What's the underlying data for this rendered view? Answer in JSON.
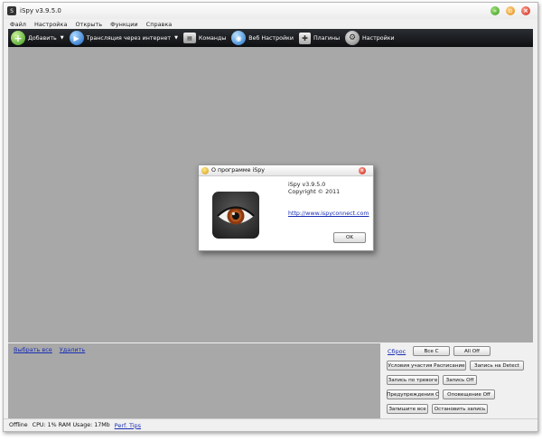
{
  "window": {
    "title": "iSpy v3.9.5.0",
    "app_icon": "S",
    "controls": [
      "minimize-icon",
      "maximize-icon",
      "close-icon"
    ]
  },
  "menu": {
    "items": [
      "Файл",
      "Настройка",
      "Открыть",
      "Функции",
      "Справка"
    ]
  },
  "toolbar": {
    "items": [
      {
        "label": "Добавить",
        "icon": "add-icon",
        "dropdown": true
      },
      {
        "label": "Трансляция через интернет",
        "icon": "broadcast-icon",
        "dropdown": true
      },
      {
        "label": "Команды",
        "icon": "commands-icon",
        "dropdown": false
      },
      {
        "label": "Веб Настройки",
        "icon": "globe-icon",
        "dropdown": false
      },
      {
        "label": "Плагины",
        "icon": "puzzle-icon",
        "dropdown": false
      },
      {
        "label": "Настройки",
        "icon": "gear-icon",
        "dropdown": false
      }
    ]
  },
  "bottom_left": {
    "select_all": "Выбрать все",
    "delete": "Удалить"
  },
  "bottom_right": {
    "reset": "Сброс",
    "all_on": "Все С",
    "all_off": "All Off",
    "schedule": "Условия участия Расписание",
    "record_on_detect": "Запись на Detect",
    "record_on_alert": "Запись по тревоге",
    "record_off": "Запись Off",
    "alerts_on": "Предупреждения С",
    "alerts_off": "Оповещение Off",
    "record_all": "Запишите все",
    "stop_recording": "Остановить запись"
  },
  "status": {
    "state": "Offline",
    "usage": "CPU: 1% RAM Usage: 17Mb",
    "tips": "Perf. Tips"
  },
  "about_dialog": {
    "title": "О программе iSpy",
    "version": "iSpy v3.9.5.0",
    "copyright": "Copyright © 2011",
    "url": "http://www.ispyconnect.com",
    "ok": "OK"
  },
  "colors": {
    "toolbar_bg": "#0e0f11",
    "workspace_bg": "#a8a8a8",
    "link": "#1a2fb4",
    "iris": "#8a3a12"
  }
}
